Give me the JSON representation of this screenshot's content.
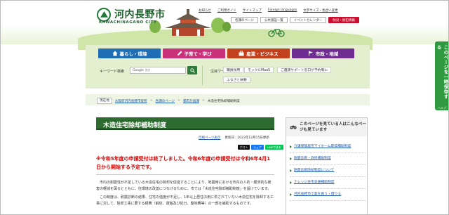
{
  "header": {
    "logo_text": "河内長野市",
    "logo_sub": "KAWACHINAGANO CITY",
    "top_links": [
      "お知らせ",
      "ご利用ガイド",
      "サイトマップ",
      "Foreign languages",
      "文字サイズ・色合い変更"
    ],
    "buttons": {
      "prev_page": "各課のページ",
      "public_relations": "公共施設一覧",
      "event_calendar": "イベントカレンダー",
      "disaster": "防災・防犯情報"
    }
  },
  "side_tab": {
    "label": "このページを一時保存する",
    "help": "ヘルプ"
  },
  "nav": {
    "categories": [
      {
        "label": "暮らし・環境",
        "color": "#1f6db5",
        "icon": "home-icon"
      },
      {
        "label": "子育て・学び",
        "color": "#c9317a",
        "icon": "pencil-icon"
      },
      {
        "label": "産業・ビジネス",
        "color": "#c2411c",
        "icon": "briefcase-icon"
      },
      {
        "label": "市政・地域",
        "color": "#6f2c91",
        "icon": "flag-icon"
      }
    ],
    "keyword_label": "キーワード検索",
    "search_provider": "Google",
    "search_hint": "提供",
    "attention_label": "注目ワード",
    "attention_chips": [
      "職員採用",
      "モックルMaaS",
      "ご遺族サポート窓口が予約制に",
      "ふるさと納税"
    ]
  },
  "breadcrumb": {
    "here": "現在地",
    "items": [
      "大阪府河内長野市役所",
      "各課のページ",
      "都市計画課",
      "木造住宅除却補助制度"
    ]
  },
  "main": {
    "title": "木造住宅除却補助制度",
    "print_label": "印刷ページ表示",
    "updated": "更新日：2023年12月15日更新",
    "share": {
      "x": "ポスト",
      "fb": "シェア",
      "line": "LINEで送る"
    },
    "notice": "※令和5年度の申請受付は終了しました。令和6年度の申請受付は令和6年4月1日から開始する予定です。",
    "body": [
      "市内の耐震性が不足している木造住宅の除却を促進することにより、地震時における市内の人的・経済的な被害の軽減を図るとともに、住環境の改善につなげるために、市では「木造住宅除却補助制度」を設けています。",
      "この制度は、耐震診断の結果、住宅の強度が不足し、1年以上居住の用に供されていない木造住宅を除却する工事に対して、除却工事に要する経費（解体、運搬及び処分、整地費等）の一部を補助するものです。"
    ]
  },
  "side_panel": {
    "title": "このページを見ている人はこんなページも見ています",
    "links": [
      "介護保険居宅マイホーム取得補助制度",
      "耐震診断・改修補助制度",
      "耐震診断除却制度について",
      "ナレッジ住宅支援補助制度",
      "河内長野市で家を買う・借りる"
    ]
  }
}
